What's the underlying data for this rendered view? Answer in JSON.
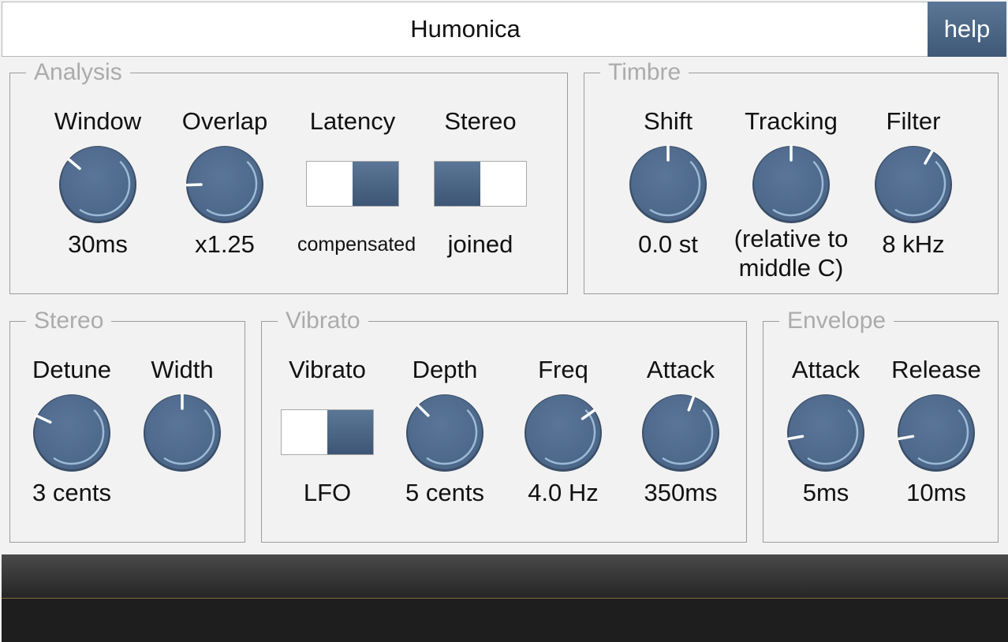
{
  "header": {
    "title": "Humonica",
    "help_label": "help"
  },
  "colors": {
    "knob": "#4a6587",
    "accent_ring": "#9cbad6",
    "pointer": "#ffffff",
    "toggle_on": "#4d6786"
  },
  "groups": {
    "analysis": {
      "title": "Analysis",
      "window": {
        "label": "Window",
        "value": "30ms"
      },
      "overlap": {
        "label": "Overlap",
        "value": "x1.25"
      },
      "latency": {
        "label": "Latency",
        "value": "compensated"
      },
      "stereo": {
        "label": "Stereo",
        "value": "joined"
      }
    },
    "timbre": {
      "title": "Timbre",
      "shift": {
        "label": "Shift",
        "value": "0.0 st"
      },
      "tracking": {
        "label": "Tracking",
        "value": "(relative to middle C)"
      },
      "filter": {
        "label": "Filter",
        "value": "8 kHz"
      }
    },
    "stereo": {
      "title": "Stereo",
      "detune": {
        "label": "Detune",
        "value": "3 cents"
      },
      "width": {
        "label": "Width",
        "value": ""
      }
    },
    "vibrato": {
      "title": "Vibrato",
      "vibrato": {
        "label": "Vibrato",
        "value": "LFO"
      },
      "depth": {
        "label": "Depth",
        "value": "5 cents"
      },
      "freq": {
        "label": "Freq",
        "value": "4.0 Hz"
      },
      "attack": {
        "label": "Attack",
        "value": "350ms"
      }
    },
    "envelope": {
      "title": "Envelope",
      "attack": {
        "label": "Attack",
        "value": "5ms"
      },
      "release": {
        "label": "Release",
        "value": "10ms"
      }
    }
  },
  "knobs": [
    {
      "id": "knob-window",
      "angle": -50
    },
    {
      "id": "knob-overlap",
      "angle": -92
    },
    {
      "id": "knob-shift",
      "angle": 0
    },
    {
      "id": "knob-tracking",
      "angle": 0
    },
    {
      "id": "knob-filter",
      "angle": 30
    },
    {
      "id": "knob-detune",
      "angle": -65
    },
    {
      "id": "knob-width",
      "angle": 0
    },
    {
      "id": "knob-depth",
      "angle": -45
    },
    {
      "id": "knob-freq",
      "angle": 55
    },
    {
      "id": "knob-attack-vib",
      "angle": 20
    },
    {
      "id": "knob-env-attack",
      "angle": -100
    },
    {
      "id": "knob-env-release",
      "angle": -100
    }
  ]
}
